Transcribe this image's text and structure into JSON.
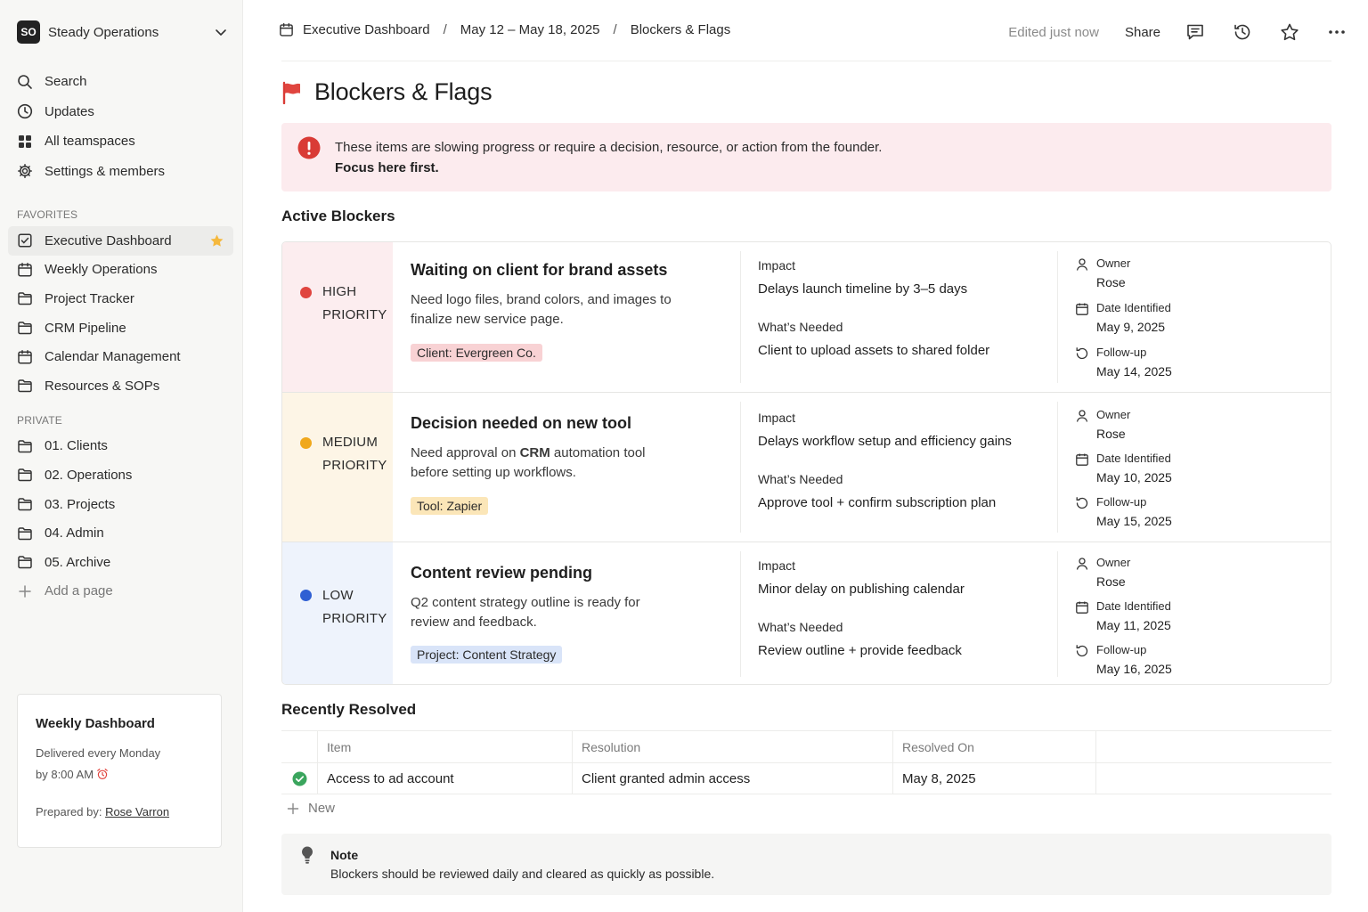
{
  "workspace": {
    "initials": "SO",
    "name": "Steady Operations"
  },
  "nav": [
    {
      "label": "Search",
      "icon": "search-icon"
    },
    {
      "label": "Updates",
      "icon": "clock-icon"
    },
    {
      "label": "All teamspaces",
      "icon": "teamspaces-icon"
    },
    {
      "label": "Settings & members",
      "icon": "gear-icon"
    }
  ],
  "favorites": {
    "label": "FAVORITES",
    "items": [
      {
        "label": "Executive Dashboard",
        "icon": "checkbox-page-icon",
        "active": true,
        "starred": true
      },
      {
        "label": "Weekly Operations",
        "icon": "calendar-icon"
      },
      {
        "label": "Project Tracker",
        "icon": "folder-icon"
      },
      {
        "label": "CRM Pipeline",
        "icon": "folder-icon"
      },
      {
        "label": "Calendar Management",
        "icon": "calendar-icon"
      },
      {
        "label": "Resources & SOPs",
        "icon": "folder-icon"
      }
    ]
  },
  "private": {
    "label": "PRIVATE",
    "items": [
      {
        "label": "01. Clients",
        "icon": "folder-icon"
      },
      {
        "label": "02. Operations",
        "icon": "folder-icon"
      },
      {
        "label": "03. Projects",
        "icon": "folder-icon"
      },
      {
        "label": "04. Admin",
        "icon": "folder-icon"
      },
      {
        "label": "05. Archive",
        "icon": "folder-icon"
      }
    ],
    "add_label": "Add a page"
  },
  "weekly_card": {
    "title": "Weekly Dashboard",
    "line1": "Delivered every Monday",
    "line2": "by 8:00 AM",
    "prepared_prefix": "Prepared by:",
    "prepared_name": "Rose Varron"
  },
  "breadcrumbs": [
    "Executive Dashboard",
    "May 12 – May 18, 2025",
    "Blockers & Flags"
  ],
  "breadcrumb_sep": "/",
  "topbar": {
    "edited": "Edited just now",
    "share": "Share"
  },
  "page": {
    "title": "Blockers & Flags",
    "callout_line1": "These items are slowing progress or require a decision, resource, or action from the founder.",
    "callout_line2": "Focus here first."
  },
  "active_heading": "Active Blockers",
  "blockers": [
    {
      "priority_line1": "HIGH",
      "priority_line2": "PRIORITY",
      "dot_color": "#e0453f",
      "bg_color": "#fcedef",
      "tag_bg": "#f8d2d4",
      "title": "Waiting on client for brand assets",
      "desc": "Need logo files, brand colors, and images to finalize new service page.",
      "tag": "Client: Evergreen Co.",
      "impact_label": "Impact",
      "impact": "Delays launch timeline by 3–5 days",
      "needed_label": "What’s Needed",
      "needed": "Client to upload assets to shared folder",
      "owner_label": "Owner",
      "owner": "Rose",
      "date_label": "Date Identified",
      "date": "May 9, 2025",
      "follow_label": "Follow-up",
      "follow": "May 14, 2025"
    },
    {
      "priority_line1": "MEDIUM",
      "priority_line2": "PRIORITY",
      "dot_color": "#f0a81c",
      "bg_color": "#fdf5e6",
      "tag_bg": "#fbe6b8",
      "title": "Decision needed on new tool",
      "desc_prefix": "Need approval on ",
      "desc_bold": "CRM",
      "desc_suffix": " automation tool before setting up workflows.",
      "tag": "Tool: Zapier",
      "impact_label": "Impact",
      "impact": "Delays workflow setup and efficiency gains",
      "needed_label": "What’s Needed",
      "needed": "Approve tool + confirm subscription plan",
      "owner_label": "Owner",
      "owner": "Rose",
      "date_label": "Date Identified",
      "date": "May 10, 2025",
      "follow_label": "Follow-up",
      "follow": "May 15, 2025"
    },
    {
      "priority_line1": "LOW",
      "priority_line2": "PRIORITY",
      "dot_color": "#2f5fd3",
      "bg_color": "#eef3fc",
      "tag_bg": "#d9e4f8",
      "title": "Content review pending",
      "desc": "Q2 content strategy outline is ready for review and feedback.",
      "tag": "Project: Content Strategy",
      "impact_label": "Impact",
      "impact": "Minor delay on publishing calendar",
      "needed_label": "What’s Needed",
      "needed": "Review outline + provide feedback",
      "owner_label": "Owner",
      "owner": "Rose",
      "date_label": "Date Identified",
      "date": "May 11, 2025",
      "follow_label": "Follow-up",
      "follow": "May 16, 2025"
    }
  ],
  "resolved": {
    "heading": "Recently Resolved",
    "columns": [
      "Item",
      "Resolution",
      "Resolved On"
    ],
    "rows": [
      {
        "item": "Access to ad account",
        "resolution": "Client granted admin access",
        "date": "May 8, 2025"
      }
    ],
    "new_label": "New"
  },
  "note": {
    "title": "Note",
    "body": "Blockers should be reviewed daily and cleared as quickly as possible."
  },
  "colors": {
    "accent_red": "#e0453f",
    "check_green": "#3aa55d",
    "star": "#f5b83d"
  }
}
